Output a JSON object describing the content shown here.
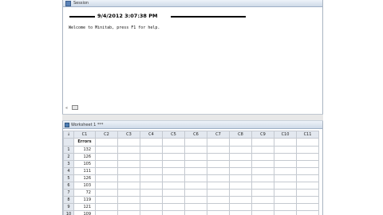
{
  "session": {
    "title": "Session",
    "date_stamp": "9/4/2012 3:07:38 PM",
    "welcome": "Welcome to Minitab, press F1 for help.",
    "prompt_glyph": "«"
  },
  "worksheet": {
    "title": "Worksheet 1 ***",
    "corner_glyph": "↓",
    "columns": [
      "C1",
      "C2",
      "C3",
      "C4",
      "C5",
      "C6",
      "C7",
      "C8",
      "C9",
      "C10",
      "C11"
    ],
    "column_names": [
      "Errors",
      "",
      "",
      "",
      "",
      "",
      "",
      "",
      "",
      "",
      ""
    ],
    "rows": [
      {
        "n": "1",
        "c1": "132"
      },
      {
        "n": "2",
        "c1": "126"
      },
      {
        "n": "3",
        "c1": "105"
      },
      {
        "n": "4",
        "c1": "111"
      },
      {
        "n": "5",
        "c1": "126"
      },
      {
        "n": "6",
        "c1": "103"
      },
      {
        "n": "7",
        "c1": "72"
      },
      {
        "n": "8",
        "c1": "119"
      },
      {
        "n": "9",
        "c1": "121"
      },
      {
        "n": "10",
        "c1": "109"
      }
    ]
  },
  "colors": {
    "title_bar": "#cfdae8",
    "header_cell": "#e3e8ef",
    "grid_line": "#c4c9d0"
  }
}
